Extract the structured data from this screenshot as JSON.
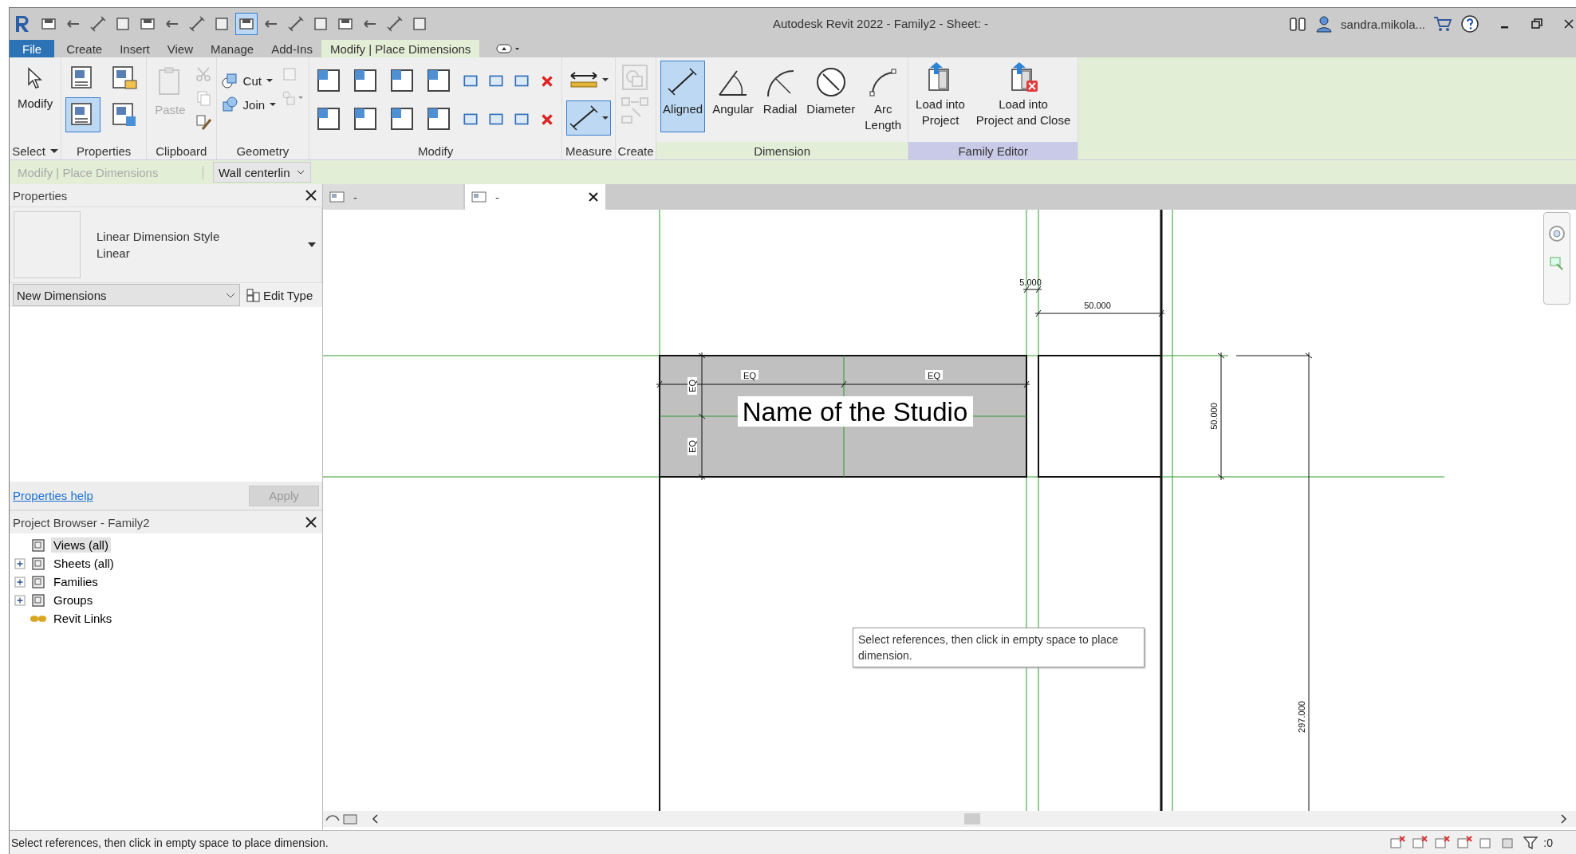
{
  "window": {
    "title": "Autodesk Revit 2022 - Family2 - Sheet:  -",
    "user": "sandra.mikola..."
  },
  "quick_access": [
    {
      "selected": false
    },
    {
      "selected": false
    },
    {
      "selected": false
    },
    {
      "selected": false
    },
    {
      "selected": false
    },
    {
      "selected": false
    },
    {
      "selected": false
    },
    {
      "selected": false
    },
    {
      "selected": true
    },
    {
      "selected": false
    },
    {
      "selected": false
    },
    {
      "selected": false
    },
    {
      "selected": false
    },
    {
      "selected": false
    },
    {
      "selected": false
    },
    {
      "selected": false
    }
  ],
  "ribbon_tabs": [
    {
      "label": "File",
      "kind": "application",
      "selected": false
    },
    {
      "label": "Create",
      "kind": "standard",
      "selected": false
    },
    {
      "label": "Insert",
      "kind": "standard",
      "selected": false
    },
    {
      "label": "View",
      "kind": "standard",
      "selected": false
    },
    {
      "label": "Manage",
      "kind": "standard",
      "selected": false
    },
    {
      "label": "Add-Ins",
      "kind": "standard",
      "selected": false
    },
    {
      "label": "Modify | Place Dimensions",
      "kind": "contextual",
      "selected": true
    }
  ],
  "ribbon_panels": [
    {
      "kind": "select",
      "title": "Select",
      "buttons": [
        {
          "label": "Modify",
          "selected": false
        }
      ]
    },
    {
      "kind": "properties",
      "title": "Properties",
      "buttons": [
        {
          "selected": false
        },
        {
          "selected": false
        },
        {
          "selected": true
        },
        {
          "selected": false
        }
      ]
    },
    {
      "kind": "clipboard",
      "title": "Clipboard",
      "buttons": [
        {
          "label": "Paste",
          "disabled": true
        }
      ]
    },
    {
      "kind": "geometry",
      "title": "Geometry",
      "buttons": [
        {
          "label": "Cut"
        },
        {
          "label": "Join"
        }
      ]
    },
    {
      "kind": "modify",
      "title": "Modify"
    },
    {
      "kind": "measure",
      "title": "Measure",
      "buttons": [
        {
          "selected": false
        },
        {
          "selected": true
        }
      ]
    },
    {
      "kind": "create",
      "title": "Create"
    },
    {
      "kind": "dimension",
      "title": "Dimension",
      "buttons": [
        {
          "label": "Aligned",
          "selected": true
        },
        {
          "label": "Angular",
          "selected": false
        },
        {
          "label": "Radial",
          "selected": false
        },
        {
          "label": "Diameter",
          "selected": false
        },
        {
          "label": "Arc\nLength",
          "selected": false
        }
      ]
    },
    {
      "kind": "family",
      "title": "Family Editor",
      "buttons": [
        {
          "label": "Load into\nProject"
        },
        {
          "label": "Load into\nProject and Close"
        }
      ]
    }
  ],
  "options_bar": {
    "context": "Modify | Place Dimensions",
    "placement": "Wall centerlin"
  },
  "properties": {
    "title": "Properties",
    "type_family": "Linear Dimension Style",
    "type_name": "Linear",
    "instance_filter": "New Dimensions",
    "edit_type": "Edit Type",
    "help_link": "Properties help",
    "apply": {
      "label": "Apply",
      "disabled": true
    }
  },
  "project_browser": {
    "title": "Project Browser - Family2",
    "items": [
      {
        "label": "Views (all)",
        "expandable": false,
        "selected": true
      },
      {
        "label": "Sheets (all)",
        "expandable": true,
        "selected": false
      },
      {
        "label": "Families",
        "expandable": true,
        "selected": false
      },
      {
        "label": "Groups",
        "expandable": true,
        "selected": false
      },
      {
        "label": "Revit Links",
        "expandable": false,
        "selected": false
      }
    ]
  },
  "view_tabs": [
    {
      "label": "-",
      "selected": false
    },
    {
      "label": "-",
      "selected": true
    }
  ],
  "canvas": {
    "dimension_labels": [
      "5.000",
      "50.000",
      "EQ",
      "EQ",
      "EQ",
      "EQ",
      "50.000",
      "297.000"
    ],
    "text_note": "Name of the Studio",
    "tooltip": "Select references, then click in empty space to place dimension."
  },
  "status_bar": {
    "message": "Select references, then click in empty space to place dimension.",
    "filter_count": ":0"
  }
}
